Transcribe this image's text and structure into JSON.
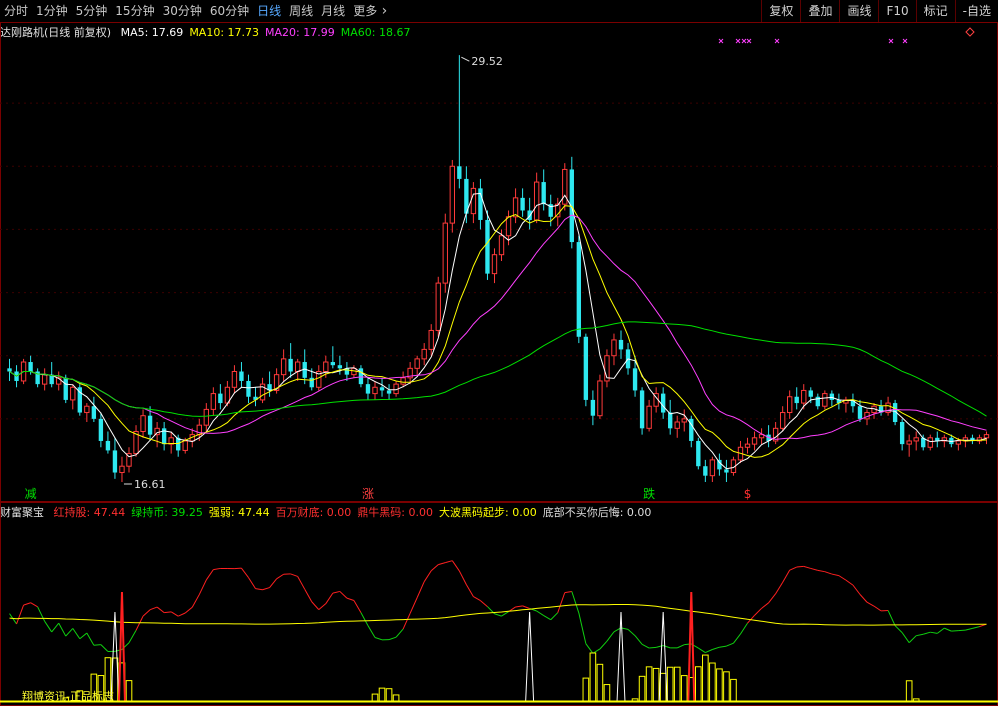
{
  "toolbar": {
    "timeframes": [
      "分时",
      "1分钟",
      "5分钟",
      "15分钟",
      "30分钟",
      "60分钟",
      "日线",
      "周线",
      "月线"
    ],
    "active_timeframe": "日线",
    "more_label": "更多",
    "right_buttons": [
      "复权",
      "叠加",
      "画线",
      "F10",
      "标记",
      "-自选"
    ]
  },
  "main": {
    "stock_title": "达刚路机(日线 前复权)",
    "ma": [
      {
        "label": "MA5: 17.69",
        "color": "#ffffff"
      },
      {
        "label": "MA10: 17.73",
        "color": "#ffff00"
      },
      {
        "label": "MA20: 17.99",
        "color": "#ff40ff"
      },
      {
        "label": "MA60: 18.67",
        "color": "#00e000"
      }
    ],
    "high_label": "29.52",
    "low_label": "16.61",
    "signals": [
      {
        "text": "减",
        "color": "#00e000"
      },
      {
        "text": "涨",
        "color": "#ff4040"
      },
      {
        "text": "跌",
        "color": "#00e000"
      },
      {
        "text": "$",
        "color": "#ff3030"
      }
    ]
  },
  "indicator": {
    "name": "财富聚宝",
    "params": [
      {
        "label": "红持股: 47.44",
        "color": "#ff3030"
      },
      {
        "label": "绿持币: 39.25",
        "color": "#00e000"
      },
      {
        "label": "强弱: 47.44",
        "color": "#ffff00"
      },
      {
        "label": "百万财底: 0.00",
        "color": "#ff3030"
      },
      {
        "label": "鼎牛黑码: 0.00",
        "color": "#ff3030"
      },
      {
        "label": "大波黑码起步: 0.00",
        "color": "#ffff00"
      },
      {
        "label": "底部不买你后悔: 0.00",
        "color": "#dddddd"
      }
    ],
    "copyright": "翔博资讯-正品标志"
  },
  "chart_data": {
    "type": "candlestick",
    "price_range": [
      16.0,
      30.0
    ],
    "high": 29.52,
    "low": 16.61,
    "candles": [
      [
        19.6,
        19.9,
        19.2,
        19.5
      ],
      [
        19.5,
        19.7,
        19.0,
        19.2
      ],
      [
        19.2,
        19.9,
        19.1,
        19.8
      ],
      [
        19.8,
        20.0,
        19.4,
        19.5
      ],
      [
        19.5,
        19.6,
        19.0,
        19.1
      ],
      [
        19.1,
        19.6,
        18.9,
        19.4
      ],
      [
        19.4,
        19.8,
        19.0,
        19.1
      ],
      [
        19.1,
        19.5,
        18.9,
        19.3
      ],
      [
        19.3,
        19.4,
        18.5,
        18.6
      ],
      [
        18.6,
        19.1,
        18.3,
        19.0
      ],
      [
        19.0,
        19.1,
        18.1,
        18.2
      ],
      [
        18.2,
        18.5,
        17.9,
        18.4
      ],
      [
        18.4,
        18.7,
        17.9,
        18.0
      ],
      [
        18.0,
        18.2,
        17.1,
        17.3
      ],
      [
        17.3,
        17.6,
        16.9,
        17.0
      ],
      [
        17.0,
        17.4,
        16.1,
        16.3
      ],
      [
        16.3,
        16.8,
        16.0,
        16.5
      ],
      [
        16.5,
        17.1,
        16.3,
        16.9
      ],
      [
        16.9,
        17.8,
        16.8,
        17.6
      ],
      [
        17.6,
        18.3,
        17.4,
        18.1
      ],
      [
        18.1,
        18.4,
        17.3,
        17.5
      ],
      [
        17.5,
        17.9,
        17.1,
        17.7
      ],
      [
        17.7,
        17.9,
        17.0,
        17.2
      ],
      [
        17.2,
        17.6,
        16.9,
        17.4
      ],
      [
        17.4,
        17.5,
        16.8,
        17.0
      ],
      [
        17.0,
        17.4,
        16.9,
        17.3
      ],
      [
        17.3,
        17.7,
        17.1,
        17.5
      ],
      [
        17.5,
        18.0,
        17.3,
        17.8
      ],
      [
        17.8,
        18.5,
        17.6,
        18.3
      ],
      [
        18.3,
        19.0,
        18.1,
        18.8
      ],
      [
        18.8,
        19.1,
        18.3,
        18.5
      ],
      [
        18.5,
        19.2,
        18.4,
        19.0
      ],
      [
        19.0,
        19.7,
        18.8,
        19.5
      ],
      [
        19.5,
        19.8,
        19.0,
        19.2
      ],
      [
        19.2,
        19.4,
        18.5,
        18.7
      ],
      [
        18.7,
        19.0,
        18.4,
        18.6
      ],
      [
        18.6,
        19.3,
        18.5,
        19.1
      ],
      [
        19.1,
        19.5,
        18.7,
        18.9
      ],
      [
        18.9,
        19.6,
        18.8,
        19.4
      ],
      [
        19.4,
        20.2,
        19.2,
        19.9
      ],
      [
        19.9,
        20.4,
        19.3,
        19.5
      ],
      [
        19.5,
        19.9,
        19.2,
        19.8
      ],
      [
        19.8,
        20.2,
        19.1,
        19.3
      ],
      [
        19.3,
        19.6,
        18.9,
        19.0
      ],
      [
        19.0,
        19.7,
        18.9,
        19.5
      ],
      [
        19.5,
        20.0,
        19.3,
        19.8
      ],
      [
        19.8,
        20.3,
        19.6,
        19.7
      ],
      [
        19.7,
        20.0,
        19.4,
        19.6
      ],
      [
        19.6,
        19.8,
        19.2,
        19.4
      ],
      [
        19.4,
        19.7,
        19.3,
        19.6
      ],
      [
        19.6,
        19.7,
        19.0,
        19.1
      ],
      [
        19.1,
        19.3,
        18.6,
        18.8
      ],
      [
        18.8,
        19.2,
        18.6,
        19.0
      ],
      [
        19.0,
        19.3,
        18.7,
        18.9
      ],
      [
        18.9,
        19.1,
        18.6,
        18.8
      ],
      [
        18.8,
        19.2,
        18.7,
        19.1
      ],
      [
        19.1,
        19.5,
        19.0,
        19.3
      ],
      [
        19.3,
        19.8,
        19.1,
        19.6
      ],
      [
        19.6,
        20.0,
        19.4,
        19.9
      ],
      [
        19.9,
        20.4,
        19.7,
        20.2
      ],
      [
        20.2,
        21.0,
        20.0,
        20.8
      ],
      [
        20.8,
        22.5,
        20.6,
        22.3
      ],
      [
        22.3,
        24.5,
        22.0,
        24.2
      ],
      [
        24.2,
        26.2,
        23.9,
        26.0
      ],
      [
        26.0,
        29.52,
        25.3,
        25.6
      ],
      [
        25.6,
        26.0,
        24.2,
        24.5
      ],
      [
        24.5,
        25.5,
        24.2,
        25.3
      ],
      [
        25.3,
        25.6,
        24.0,
        24.3
      ],
      [
        24.3,
        24.6,
        22.4,
        22.6
      ],
      [
        22.6,
        23.4,
        22.3,
        23.2
      ],
      [
        23.2,
        24.0,
        23.0,
        23.8
      ],
      [
        23.8,
        24.6,
        23.5,
        24.4
      ],
      [
        24.4,
        25.3,
        24.2,
        25.0
      ],
      [
        25.0,
        25.3,
        24.4,
        24.6
      ],
      [
        24.6,
        25.0,
        24.0,
        24.3
      ],
      [
        24.3,
        25.8,
        24.2,
        25.5
      ],
      [
        25.5,
        25.9,
        24.6,
        24.8
      ],
      [
        24.8,
        25.1,
        24.1,
        24.4
      ],
      [
        24.4,
        25.0,
        24.1,
        24.8
      ],
      [
        24.8,
        26.1,
        24.6,
        25.9
      ],
      [
        25.9,
        26.3,
        23.4,
        23.6
      ],
      [
        23.6,
        23.8,
        20.4,
        20.6
      ],
      [
        20.6,
        20.7,
        18.4,
        18.6
      ],
      [
        18.6,
        18.9,
        17.8,
        18.1
      ],
      [
        18.1,
        19.4,
        18.0,
        19.2
      ],
      [
        19.2,
        20.2,
        19.0,
        20.0
      ],
      [
        20.0,
        20.7,
        19.7,
        20.5
      ],
      [
        20.5,
        20.8,
        19.9,
        20.2
      ],
      [
        20.2,
        20.4,
        19.4,
        19.6
      ],
      [
        19.6,
        20.0,
        18.7,
        18.9
      ],
      [
        18.9,
        19.0,
        17.5,
        17.7
      ],
      [
        17.7,
        18.6,
        17.6,
        18.4
      ],
      [
        18.4,
        19.0,
        18.2,
        18.8
      ],
      [
        18.8,
        19.0,
        18.0,
        18.2
      ],
      [
        18.2,
        18.6,
        17.5,
        17.7
      ],
      [
        17.7,
        18.1,
        17.4,
        17.9
      ],
      [
        17.9,
        18.3,
        17.6,
        18.0
      ],
      [
        18.0,
        18.1,
        17.1,
        17.3
      ],
      [
        17.3,
        17.4,
        16.4,
        16.5
      ],
      [
        16.5,
        16.7,
        16.0,
        16.2
      ],
      [
        16.2,
        16.8,
        16.0,
        16.7
      ],
      [
        16.7,
        16.9,
        16.2,
        16.4
      ],
      [
        16.4,
        16.7,
        16.0,
        16.3
      ],
      [
        16.3,
        16.8,
        16.2,
        16.7
      ],
      [
        16.7,
        17.3,
        16.6,
        17.1
      ],
      [
        17.1,
        17.4,
        16.9,
        17.2
      ],
      [
        17.2,
        17.6,
        17.0,
        17.4
      ],
      [
        17.4,
        17.7,
        17.2,
        17.5
      ],
      [
        17.5,
        17.8,
        17.1,
        17.3
      ],
      [
        17.3,
        17.9,
        17.2,
        17.7
      ],
      [
        17.7,
        18.4,
        17.6,
        18.2
      ],
      [
        18.2,
        18.9,
        18.0,
        18.7
      ],
      [
        18.7,
        19.0,
        18.3,
        18.5
      ],
      [
        18.5,
        19.1,
        18.3,
        18.9
      ],
      [
        18.9,
        19.0,
        18.5,
        18.7
      ],
      [
        18.7,
        18.8,
        18.3,
        18.4
      ],
      [
        18.4,
        18.9,
        18.3,
        18.8
      ],
      [
        18.8,
        18.9,
        18.4,
        18.6
      ],
      [
        18.6,
        18.8,
        18.3,
        18.5
      ],
      [
        18.5,
        18.7,
        18.2,
        18.6
      ],
      [
        18.6,
        18.8,
        18.2,
        18.4
      ],
      [
        18.4,
        18.6,
        17.9,
        18.0
      ],
      [
        18.0,
        18.3,
        17.8,
        18.2
      ],
      [
        18.2,
        18.5,
        18.0,
        18.4
      ],
      [
        18.4,
        18.6,
        18.1,
        18.2
      ],
      [
        18.2,
        18.7,
        18.1,
        18.5
      ],
      [
        18.5,
        18.6,
        17.8,
        17.9
      ],
      [
        17.9,
        18.0,
        17.0,
        17.2
      ],
      [
        17.2,
        17.5,
        16.8,
        17.3
      ],
      [
        17.3,
        17.6,
        17.0,
        17.4
      ],
      [
        17.4,
        17.5,
        17.0,
        17.1
      ],
      [
        17.1,
        17.5,
        17.0,
        17.4
      ],
      [
        17.4,
        17.6,
        17.1,
        17.3
      ],
      [
        17.3,
        17.5,
        17.1,
        17.4
      ],
      [
        17.4,
        17.5,
        17.1,
        17.2
      ],
      [
        17.2,
        17.4,
        17.0,
        17.3
      ],
      [
        17.3,
        17.5,
        17.1,
        17.4
      ],
      [
        17.4,
        17.5,
        17.2,
        17.3
      ],
      [
        17.3,
        17.5,
        17.2,
        17.4
      ],
      [
        17.4,
        17.6,
        17.2,
        17.5
      ]
    ]
  }
}
